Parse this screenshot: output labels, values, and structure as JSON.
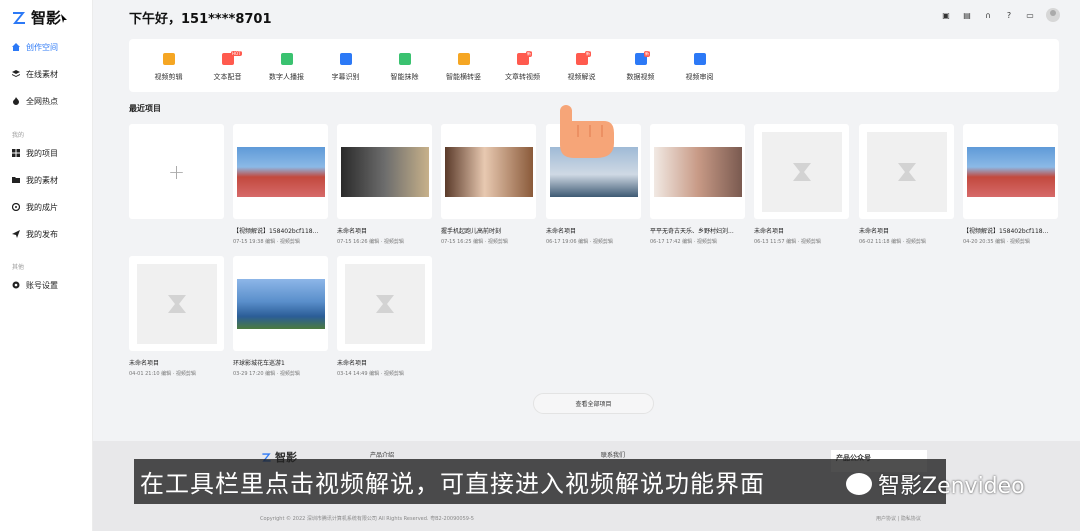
{
  "app": {
    "name": "智影"
  },
  "sidebar": {
    "items": [
      {
        "label": "创作空间",
        "icon": "home-icon",
        "active": true
      },
      {
        "label": "在线素材",
        "icon": "layers-icon"
      },
      {
        "label": "全网热点",
        "icon": "flame-icon"
      }
    ],
    "section_mine": "我的",
    "mine_items": [
      {
        "label": "我的项目",
        "icon": "grid-icon"
      },
      {
        "label": "我的素材",
        "icon": "folder-icon"
      },
      {
        "label": "我的成片",
        "icon": "film-icon"
      },
      {
        "label": "我的发布",
        "icon": "send-icon"
      }
    ],
    "section_other": "其他",
    "other_items": [
      {
        "label": "账号设置",
        "icon": "gear-icon"
      }
    ]
  },
  "header": {
    "greeting": "下午好，151****8701"
  },
  "toolbar": {
    "tools": [
      {
        "label": "视频剪辑",
        "color": "#f5a623"
      },
      {
        "label": "文本配音",
        "color": "#ff5a4e",
        "badge": "HOT"
      },
      {
        "label": "数字人播报",
        "color": "#3ac270"
      },
      {
        "label": "字幕识别",
        "color": "#2c79f6"
      },
      {
        "label": "智能抹除",
        "color": "#3ac270"
      },
      {
        "label": "智能横转竖",
        "color": "#f5a623"
      },
      {
        "label": "文章转视频",
        "color": "#ff5a4e",
        "badge": "新"
      },
      {
        "label": "视频解说",
        "color": "#ff5a4e",
        "badge": "新"
      },
      {
        "label": "数据视频",
        "color": "#2c79f6",
        "badge": "新"
      },
      {
        "label": "视频审阅",
        "color": "#2c79f6"
      }
    ]
  },
  "recent": {
    "title": "最近项目",
    "view_all": "查看全部项目",
    "cards": [
      {
        "name": "【视频解说】158402bcf118...",
        "meta": "07-15 19:38 编辑 · 视频剪辑"
      },
      {
        "name": "未命名项目",
        "meta": "07-15 16:26 编辑 · 视频剪辑"
      },
      {
        "name": "握手机起跑儿高前时刻",
        "meta": "07-15 16:25 编辑 · 视频剪辑"
      },
      {
        "name": "未命名项目",
        "meta": "06-17 19:06 编辑 · 视频剪辑"
      },
      {
        "name": "平平无奇古天乐、乡野村妇刘...",
        "meta": "06-17 17:42 编辑 · 视频剪辑"
      },
      {
        "name": "未命名项目",
        "meta": "06-13 11:57 编辑 · 视频剪辑"
      },
      {
        "name": "未命名项目",
        "meta": "06-02 11:18 编辑 · 视频剪辑"
      },
      {
        "name": "【视频解说】158402bcf118...",
        "meta": "04-20 20:35 编辑 · 视频剪辑"
      },
      {
        "name": "未命名项目",
        "meta": "04-01 21:10 编辑 · 视频剪辑"
      },
      {
        "name": "环球影城花车巡游1",
        "meta": "03-29 17:20 编辑 · 视频剪辑"
      },
      {
        "name": "未命名项目",
        "meta": "03-14 14:49 编辑 · 视频剪辑"
      }
    ]
  },
  "footer": {
    "logo": "智影",
    "product_intro": "产品介绍",
    "contact": "联系我们",
    "qr": "产品公众号",
    "copyright": "Copyright © 2022 深圳市腾讯计算机系统有限公司 All Rights Reserved.    粤B2-20090059-5",
    "links": "用户协议  |  隐私协议"
  },
  "subtitle": "在工具栏里点击视频解说，可直接进入视频解说功能界面",
  "watermark": "智影Zenvideo"
}
